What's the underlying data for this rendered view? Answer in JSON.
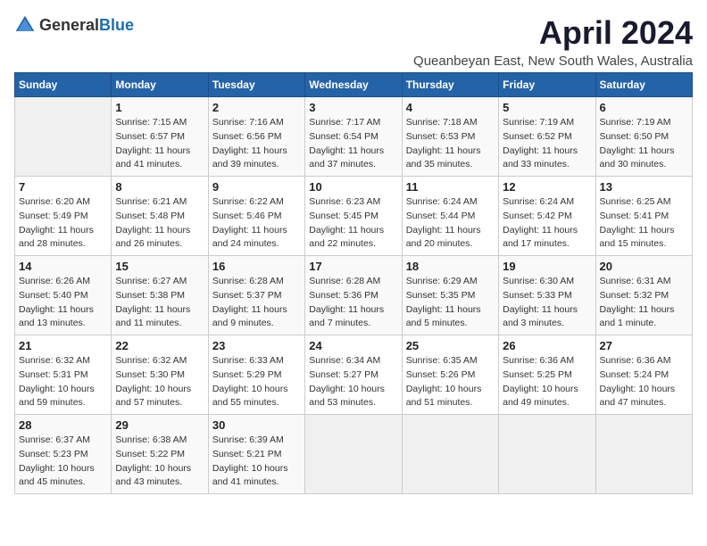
{
  "header": {
    "logo_general": "General",
    "logo_blue": "Blue",
    "title": "April 2024",
    "subtitle": "Queanbeyan East, New South Wales, Australia"
  },
  "days_of_week": [
    "Sunday",
    "Monday",
    "Tuesday",
    "Wednesday",
    "Thursday",
    "Friday",
    "Saturday"
  ],
  "weeks": [
    [
      {
        "day": "",
        "info": ""
      },
      {
        "day": "1",
        "info": "Sunrise: 7:15 AM\nSunset: 6:57 PM\nDaylight: 11 hours\nand 41 minutes."
      },
      {
        "day": "2",
        "info": "Sunrise: 7:16 AM\nSunset: 6:56 PM\nDaylight: 11 hours\nand 39 minutes."
      },
      {
        "day": "3",
        "info": "Sunrise: 7:17 AM\nSunset: 6:54 PM\nDaylight: 11 hours\nand 37 minutes."
      },
      {
        "day": "4",
        "info": "Sunrise: 7:18 AM\nSunset: 6:53 PM\nDaylight: 11 hours\nand 35 minutes."
      },
      {
        "day": "5",
        "info": "Sunrise: 7:19 AM\nSunset: 6:52 PM\nDaylight: 11 hours\nand 33 minutes."
      },
      {
        "day": "6",
        "info": "Sunrise: 7:19 AM\nSunset: 6:50 PM\nDaylight: 11 hours\nand 30 minutes."
      }
    ],
    [
      {
        "day": "7",
        "info": "Sunrise: 6:20 AM\nSunset: 5:49 PM\nDaylight: 11 hours\nand 28 minutes."
      },
      {
        "day": "8",
        "info": "Sunrise: 6:21 AM\nSunset: 5:48 PM\nDaylight: 11 hours\nand 26 minutes."
      },
      {
        "day": "9",
        "info": "Sunrise: 6:22 AM\nSunset: 5:46 PM\nDaylight: 11 hours\nand 24 minutes."
      },
      {
        "day": "10",
        "info": "Sunrise: 6:23 AM\nSunset: 5:45 PM\nDaylight: 11 hours\nand 22 minutes."
      },
      {
        "day": "11",
        "info": "Sunrise: 6:24 AM\nSunset: 5:44 PM\nDaylight: 11 hours\nand 20 minutes."
      },
      {
        "day": "12",
        "info": "Sunrise: 6:24 AM\nSunset: 5:42 PM\nDaylight: 11 hours\nand 17 minutes."
      },
      {
        "day": "13",
        "info": "Sunrise: 6:25 AM\nSunset: 5:41 PM\nDaylight: 11 hours\nand 15 minutes."
      }
    ],
    [
      {
        "day": "14",
        "info": "Sunrise: 6:26 AM\nSunset: 5:40 PM\nDaylight: 11 hours\nand 13 minutes."
      },
      {
        "day": "15",
        "info": "Sunrise: 6:27 AM\nSunset: 5:38 PM\nDaylight: 11 hours\nand 11 minutes."
      },
      {
        "day": "16",
        "info": "Sunrise: 6:28 AM\nSunset: 5:37 PM\nDaylight: 11 hours\nand 9 minutes."
      },
      {
        "day": "17",
        "info": "Sunrise: 6:28 AM\nSunset: 5:36 PM\nDaylight: 11 hours\nand 7 minutes."
      },
      {
        "day": "18",
        "info": "Sunrise: 6:29 AM\nSunset: 5:35 PM\nDaylight: 11 hours\nand 5 minutes."
      },
      {
        "day": "19",
        "info": "Sunrise: 6:30 AM\nSunset: 5:33 PM\nDaylight: 11 hours\nand 3 minutes."
      },
      {
        "day": "20",
        "info": "Sunrise: 6:31 AM\nSunset: 5:32 PM\nDaylight: 11 hours\nand 1 minute."
      }
    ],
    [
      {
        "day": "21",
        "info": "Sunrise: 6:32 AM\nSunset: 5:31 PM\nDaylight: 10 hours\nand 59 minutes."
      },
      {
        "day": "22",
        "info": "Sunrise: 6:32 AM\nSunset: 5:30 PM\nDaylight: 10 hours\nand 57 minutes."
      },
      {
        "day": "23",
        "info": "Sunrise: 6:33 AM\nSunset: 5:29 PM\nDaylight: 10 hours\nand 55 minutes."
      },
      {
        "day": "24",
        "info": "Sunrise: 6:34 AM\nSunset: 5:27 PM\nDaylight: 10 hours\nand 53 minutes."
      },
      {
        "day": "25",
        "info": "Sunrise: 6:35 AM\nSunset: 5:26 PM\nDaylight: 10 hours\nand 51 minutes."
      },
      {
        "day": "26",
        "info": "Sunrise: 6:36 AM\nSunset: 5:25 PM\nDaylight: 10 hours\nand 49 minutes."
      },
      {
        "day": "27",
        "info": "Sunrise: 6:36 AM\nSunset: 5:24 PM\nDaylight: 10 hours\nand 47 minutes."
      }
    ],
    [
      {
        "day": "28",
        "info": "Sunrise: 6:37 AM\nSunset: 5:23 PM\nDaylight: 10 hours\nand 45 minutes."
      },
      {
        "day": "29",
        "info": "Sunrise: 6:38 AM\nSunset: 5:22 PM\nDaylight: 10 hours\nand 43 minutes."
      },
      {
        "day": "30",
        "info": "Sunrise: 6:39 AM\nSunset: 5:21 PM\nDaylight: 10 hours\nand 41 minutes."
      },
      {
        "day": "",
        "info": ""
      },
      {
        "day": "",
        "info": ""
      },
      {
        "day": "",
        "info": ""
      },
      {
        "day": "",
        "info": ""
      }
    ]
  ]
}
